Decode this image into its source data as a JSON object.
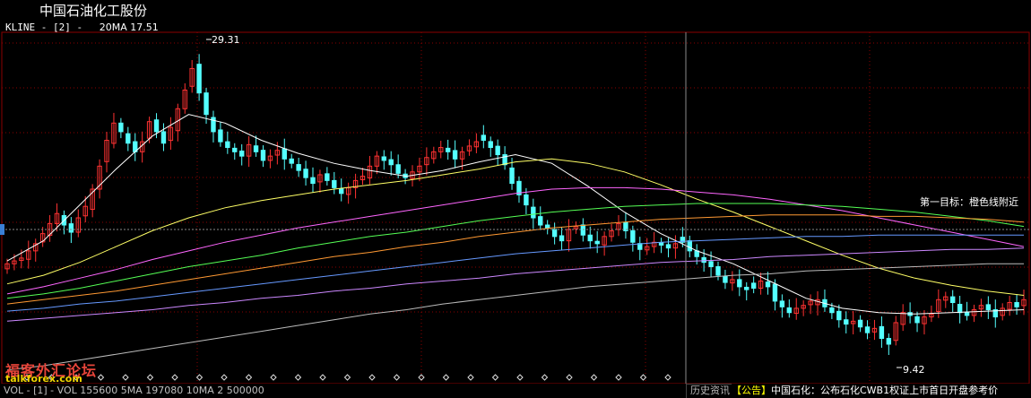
{
  "window": {
    "title": "中国石油化工股份"
  },
  "legend": {
    "indicator": "KLINE - [2] -",
    "ma_label": "20MA 17.51"
  },
  "annotations": {
    "high": "29.31",
    "low": "9.42",
    "target_note": "第一目标：橙色线附近"
  },
  "bottom": {
    "volume_label": "VOL - [1] - VOL 155600 5MA 197080 10MA 2 500000",
    "history_button": "历史资讯",
    "ticker_tag": "【公告】",
    "ticker_text": "中国石化：公布石化CWB1权证上市首日开盘参考价"
  },
  "watermark": {
    "line1": "福客外汇论坛",
    "line2": "talkforex.com"
  },
  "colors": {
    "up": "#ff3232",
    "down": "#54ffff",
    "grid": "#8b0000",
    "cursor": "#8a8a8a",
    "ma": [
      "#ffffff",
      "#ffff66",
      "#ff66ff",
      "#55ff55",
      "#ff9933",
      "#6699ff",
      "#cc88ff",
      "#bbbbbb"
    ]
  },
  "chart_data": {
    "type": "candlestick",
    "y_range": [
      7.8,
      31.4
    ],
    "high_value": 29.31,
    "low_value": 9.42,
    "closes": [
      15.4,
      15.6,
      15.8,
      16.3,
      16.8,
      17.5,
      18.2,
      18.9,
      18.1,
      17.6,
      18.6,
      19.4,
      20.6,
      22.2,
      24.0,
      25.2,
      24.6,
      23.8,
      23.2,
      23.9,
      25.3,
      24.6,
      23.8,
      24.9,
      26.2,
      27.5,
      29.0,
      27.3,
      25.8,
      24.6,
      23.9,
      23.5,
      23.2,
      22.9,
      23.7,
      23.2,
      22.6,
      22.9,
      23.3,
      22.7,
      22.4,
      21.9,
      21.4,
      21.0,
      21.6,
      21.2,
      20.7,
      20.3,
      20.7,
      21.2,
      21.5,
      22.2,
      22.9,
      22.6,
      22.3,
      21.7,
      21.4,
      21.8,
      22.2,
      22.8,
      23.2,
      23.5,
      23.2,
      22.7,
      23.2,
      23.6,
      23.9,
      24.0,
      23.5,
      23.0,
      22.3,
      21.0,
      20.2,
      19.5,
      18.6,
      18.1,
      17.9,
      17.3,
      17.0,
      17.8,
      18.0,
      17.4,
      17.0,
      16.8,
      17.3,
      17.7,
      18.2,
      17.7,
      16.9,
      16.4,
      16.6,
      16.9,
      16.7,
      16.5,
      16.8,
      16.9,
      16.3,
      15.9,
      15.5,
      15.2,
      14.6,
      14.1,
      14.3,
      13.8,
      13.6,
      13.7,
      14.2,
      13.8,
      12.8,
      12.4,
      12.0,
      12.3,
      12.5,
      12.8,
      12.9,
      12.4,
      12.0,
      11.5,
      11.2,
      11.4,
      11.0,
      10.6,
      10.9,
      10.2,
      9.8,
      11.3,
      12.0,
      11.8,
      11.3,
      11.7,
      11.9,
      12.9,
      13.1,
      12.7,
      12.0,
      11.8,
      12.2,
      12.5,
      12.2,
      11.7,
      12.3,
      12.7,
      12.4,
      12.9
    ],
    "moving_averages": [
      [
        15.6,
        17.0,
        19.5,
        22.0,
        24.3,
        25.8,
        25.2,
        24.0,
        23.1,
        22.4,
        21.9,
        21.5,
        21.9,
        22.5,
        23.0,
        22.4,
        20.8,
        19.0,
        17.5,
        16.3,
        15.4,
        14.2,
        13.0,
        12.3,
        12.0,
        11.9,
        12.0,
        12.1,
        12.2
      ],
      [
        14.0,
        14.6,
        15.5,
        16.6,
        17.7,
        18.6,
        19.3,
        19.8,
        20.2,
        20.6,
        20.9,
        21.2,
        21.6,
        22.0,
        22.5,
        22.7,
        22.4,
        21.8,
        20.9,
        19.9,
        19.0,
        18.0,
        17.0,
        16.0,
        15.1,
        14.4,
        13.9,
        13.5,
        13.2
      ],
      [
        13.3,
        13.8,
        14.4,
        15.0,
        15.7,
        16.3,
        16.9,
        17.4,
        17.9,
        18.3,
        18.7,
        19.1,
        19.5,
        19.9,
        20.3,
        20.6,
        20.7,
        20.7,
        20.6,
        20.4,
        20.2,
        19.9,
        19.5,
        19.1,
        18.6,
        18.1,
        17.6,
        17.1,
        16.6
      ],
      [
        13.0,
        13.3,
        13.7,
        14.2,
        14.7,
        15.2,
        15.6,
        16.0,
        16.5,
        16.9,
        17.3,
        17.6,
        18.0,
        18.4,
        18.7,
        19.0,
        19.2,
        19.4,
        19.5,
        19.6,
        19.6,
        19.6,
        19.5,
        19.4,
        19.2,
        19.0,
        18.7,
        18.4,
        18.0
      ],
      [
        12.6,
        12.9,
        13.2,
        13.5,
        13.9,
        14.3,
        14.7,
        15.1,
        15.5,
        15.9,
        16.2,
        16.6,
        16.9,
        17.3,
        17.6,
        17.9,
        18.1,
        18.3,
        18.5,
        18.6,
        18.7,
        18.8,
        18.8,
        18.8,
        18.7,
        18.7,
        18.6,
        18.5,
        18.3
      ],
      [
        12.1,
        12.3,
        12.6,
        12.8,
        13.1,
        13.4,
        13.7,
        14.0,
        14.3,
        14.6,
        14.9,
        15.2,
        15.5,
        15.8,
        16.1,
        16.3,
        16.5,
        16.7,
        16.9,
        17.0,
        17.1,
        17.2,
        17.3,
        17.3,
        17.4,
        17.4,
        17.4,
        17.4,
        17.4
      ],
      [
        11.4,
        11.6,
        11.8,
        12.0,
        12.2,
        12.5,
        12.7,
        13.0,
        13.2,
        13.5,
        13.7,
        14.0,
        14.2,
        14.4,
        14.7,
        14.9,
        15.1,
        15.3,
        15.5,
        15.6,
        15.7,
        15.9,
        16.0,
        16.1,
        16.2,
        16.3,
        16.4,
        16.4,
        16.5
      ],
      [
        8.0,
        8.3,
        8.7,
        9.1,
        9.5,
        9.9,
        10.3,
        10.7,
        11.1,
        11.5,
        11.9,
        12.2,
        12.6,
        12.9,
        13.2,
        13.5,
        13.8,
        14.0,
        14.2,
        14.4,
        14.6,
        14.7,
        14.9,
        15.0,
        15.1,
        15.2,
        15.3,
        15.4,
        15.4
      ]
    ]
  }
}
